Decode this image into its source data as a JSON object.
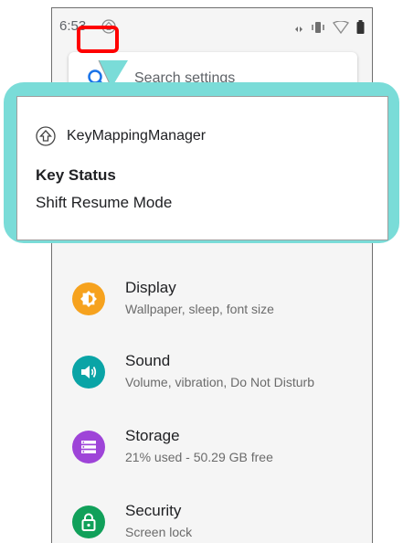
{
  "status_bar": {
    "time": "6:53",
    "icons": [
      "key-mapping-status-icon",
      "nfc-icon",
      "vibrate-icon",
      "wifi-icon",
      "battery-icon"
    ]
  },
  "search": {
    "placeholder": "Search settings"
  },
  "notification": {
    "app_name": "KeyMappingManager",
    "title": "Key Status",
    "text": "Shift Resume Mode"
  },
  "settings": {
    "items": [
      {
        "title": "Display",
        "subtitle": "Wallpaper, sleep, font size",
        "icon": "display-icon",
        "color": "#f6a21e"
      },
      {
        "title": "Sound",
        "subtitle": "Volume, vibration, Do Not Disturb",
        "icon": "sound-icon",
        "color": "#0aa4a6"
      },
      {
        "title": "Storage",
        "subtitle": "21% used - 50.29 GB free",
        "icon": "storage-icon",
        "color": "#9e44d8"
      },
      {
        "title": "Security",
        "subtitle": "Screen lock",
        "icon": "security-icon",
        "color": "#11a05a"
      }
    ]
  },
  "colors": {
    "callout": "#7adcd8",
    "highlight": "#ff0000"
  }
}
